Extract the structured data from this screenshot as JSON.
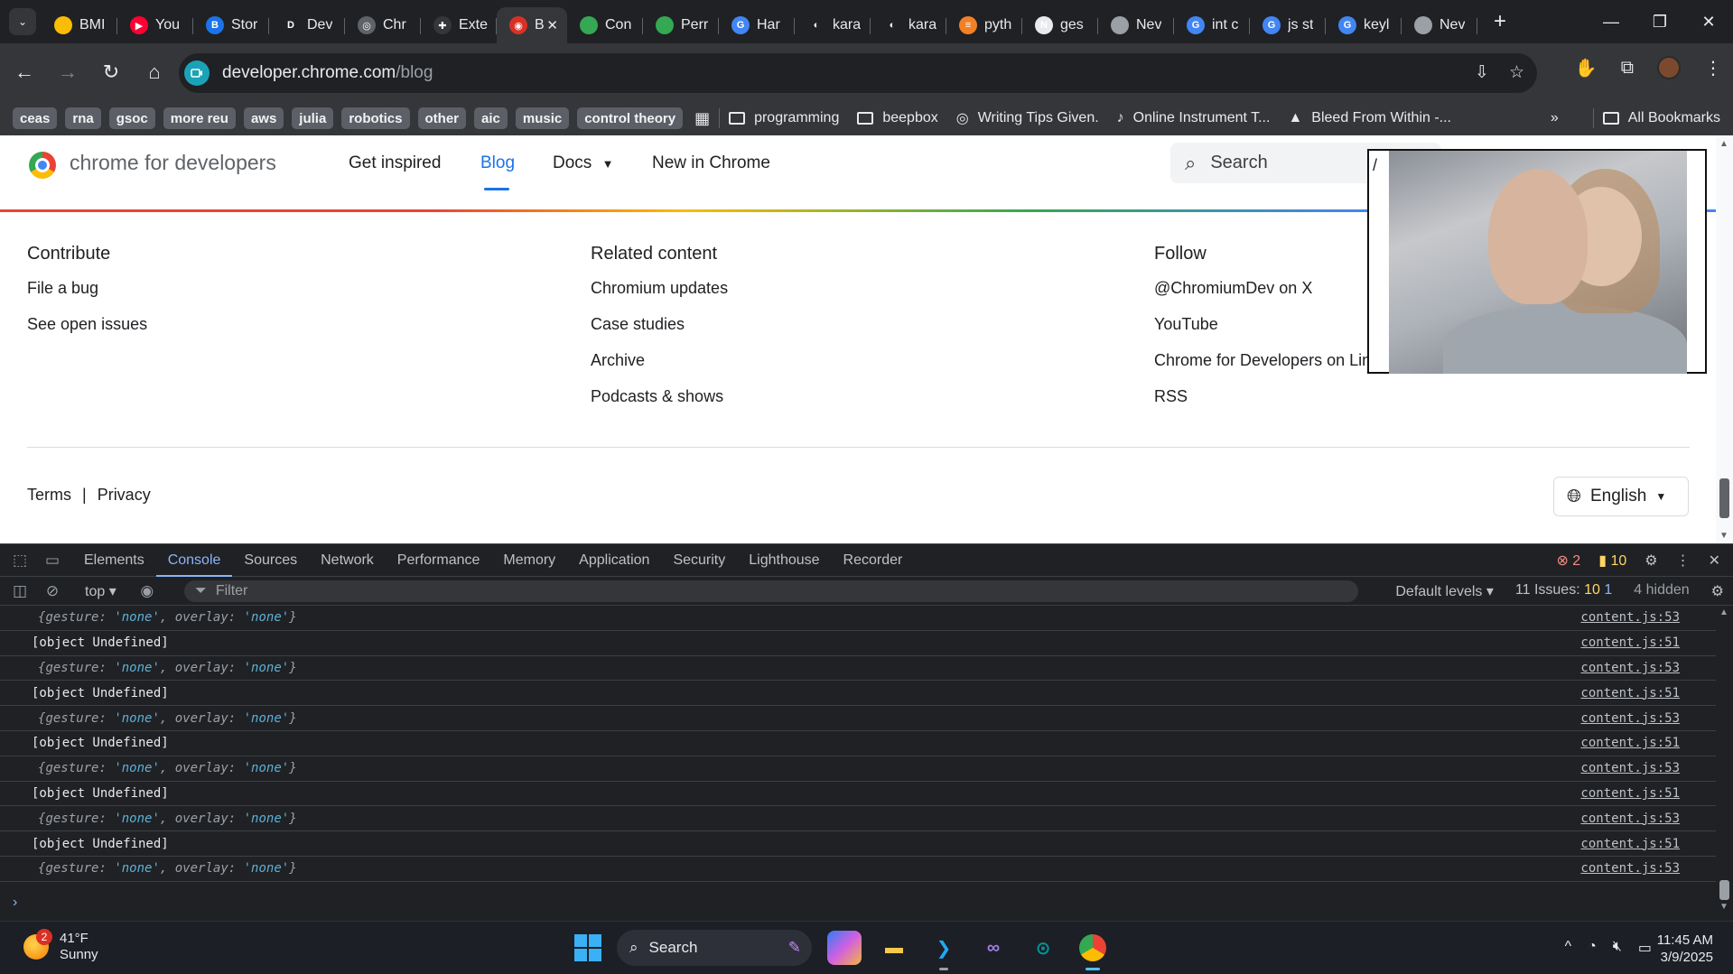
{
  "browser": {
    "tabs": [
      {
        "title": "BMI",
        "icon": "bookmark-favicon",
        "color": "#fbbc04",
        "glyph": ""
      },
      {
        "title": "You",
        "icon": "youtube-favicon",
        "color": "#ff0033",
        "glyph": "▶"
      },
      {
        "title": "Stor",
        "icon": "storybook-favicon",
        "color": "#1a73e8",
        "glyph": "B"
      },
      {
        "title": "Dev",
        "icon": "dev-favicon",
        "color": "#202124",
        "glyph": "D"
      },
      {
        "title": "Chr",
        "icon": "openai-favicon",
        "color": "#5f6368",
        "glyph": "◎"
      },
      {
        "title": "Exte",
        "icon": "extension-favicon",
        "color": "#35363a",
        "glyph": "✚"
      },
      {
        "title": "B",
        "icon": "recording-favicon",
        "color": "#d93025",
        "glyph": "◉",
        "active": true
      },
      {
        "title": "Con",
        "icon": "chrome-favicon",
        "color": "#34a853",
        "glyph": ""
      },
      {
        "title": "Perr",
        "icon": "chrome-favicon",
        "color": "#34a853",
        "glyph": ""
      },
      {
        "title": "Har",
        "icon": "google-favicon",
        "color": "#4285f4",
        "glyph": "G"
      },
      {
        "title": "kara",
        "icon": "github-favicon",
        "color": "#202124",
        "glyph": "◐"
      },
      {
        "title": "kara",
        "icon": "github-favicon",
        "color": "#202124",
        "glyph": "◐"
      },
      {
        "title": "pyth",
        "icon": "stackoverflow-favicon",
        "color": "#f48024",
        "glyph": "≡"
      },
      {
        "title": "ges",
        "icon": "notion-favicon",
        "color": "#e8eaed",
        "glyph": "N"
      },
      {
        "title": "Nev",
        "icon": "chrome-favicon",
        "color": "#9aa0a6",
        "glyph": ""
      },
      {
        "title": "int c",
        "icon": "google-favicon",
        "color": "#4285f4",
        "glyph": "G"
      },
      {
        "title": "js st",
        "icon": "google-favicon",
        "color": "#4285f4",
        "glyph": "G"
      },
      {
        "title": "keyl",
        "icon": "google-favicon",
        "color": "#4285f4",
        "glyph": "G"
      },
      {
        "title": "Nev",
        "icon": "chrome-favicon",
        "color": "#9aa0a6",
        "glyph": ""
      }
    ],
    "url_host": "developer.chrome.com",
    "url_path": "/blog",
    "bookmark_chips": [
      "ceas",
      "rna",
      "gsoc",
      "more reu",
      "aws",
      "julia",
      "robotics",
      "other",
      "aic",
      "music",
      "control theory"
    ],
    "bookmarks": [
      {
        "label": "programming",
        "icon": "folder-icon"
      },
      {
        "label": "beepbox",
        "icon": "folder-icon"
      },
      {
        "label": "Writing Tips Given.",
        "icon": "openai-icon"
      },
      {
        "label": "Online Instrument T...",
        "icon": "instrument-icon"
      },
      {
        "label": "Bleed From Within -...",
        "icon": "drive-icon"
      }
    ],
    "all_bookmarks": "All Bookmarks"
  },
  "page": {
    "brand": "chrome for developers",
    "nav": [
      "Get inspired",
      "Blog",
      "Docs",
      "New in Chrome"
    ],
    "search_placeholder": "Search",
    "columns": [
      {
        "heading": "Contribute",
        "links": [
          "File a bug",
          "See open issues"
        ]
      },
      {
        "heading": "Related content",
        "links": [
          "Chromium updates",
          "Case studies",
          "Archive",
          "Podcasts & shows"
        ]
      },
      {
        "heading": "Follow",
        "links": [
          "@ChromiumDev on X",
          "YouTube",
          "Chrome for Developers on LinkedIn",
          "RSS"
        ]
      }
    ],
    "legal": {
      "terms": "Terms",
      "sep": "|",
      "privacy": "Privacy"
    },
    "language": "English",
    "overlay_char": "/"
  },
  "devtools": {
    "tabs": [
      "Elements",
      "Console",
      "Sources",
      "Network",
      "Performance",
      "Memory",
      "Application",
      "Security",
      "Lighthouse",
      "Recorder"
    ],
    "active_tab": "Console",
    "errors": "2",
    "warnings": "10",
    "context": "top",
    "filter_placeholder": "Filter",
    "levels": "Default levels",
    "issues_label": "11 Issues:",
    "issues_warn": "10",
    "issues_info": "1",
    "hidden": "4 hidden",
    "log": [
      {
        "type": "obj",
        "src": "content.js:53"
      },
      {
        "type": "text",
        "text": "[object Undefined]",
        "src": "content.js:51"
      },
      {
        "type": "obj",
        "src": "content.js:53"
      },
      {
        "type": "text",
        "text": "[object Undefined]",
        "src": "content.js:51"
      },
      {
        "type": "obj",
        "src": "content.js:53"
      },
      {
        "type": "text",
        "text": "[object Undefined]",
        "src": "content.js:51"
      },
      {
        "type": "obj",
        "src": "content.js:53"
      },
      {
        "type": "text",
        "text": "[object Undefined]",
        "src": "content.js:51"
      },
      {
        "type": "obj",
        "src": "content.js:53"
      },
      {
        "type": "text",
        "text": "[object Undefined]",
        "src": "content.js:51"
      },
      {
        "type": "obj",
        "src": "content.js:53"
      }
    ],
    "obj_key1": "gesture",
    "obj_val1": "'none'",
    "obj_key2": "overlay",
    "obj_val2": "'none'"
  },
  "taskbar": {
    "weather_temp": "41°F",
    "weather_desc": "Sunny",
    "weather_badge": "2",
    "search": "Search",
    "time": "11:45 AM",
    "date": "3/9/2025"
  }
}
